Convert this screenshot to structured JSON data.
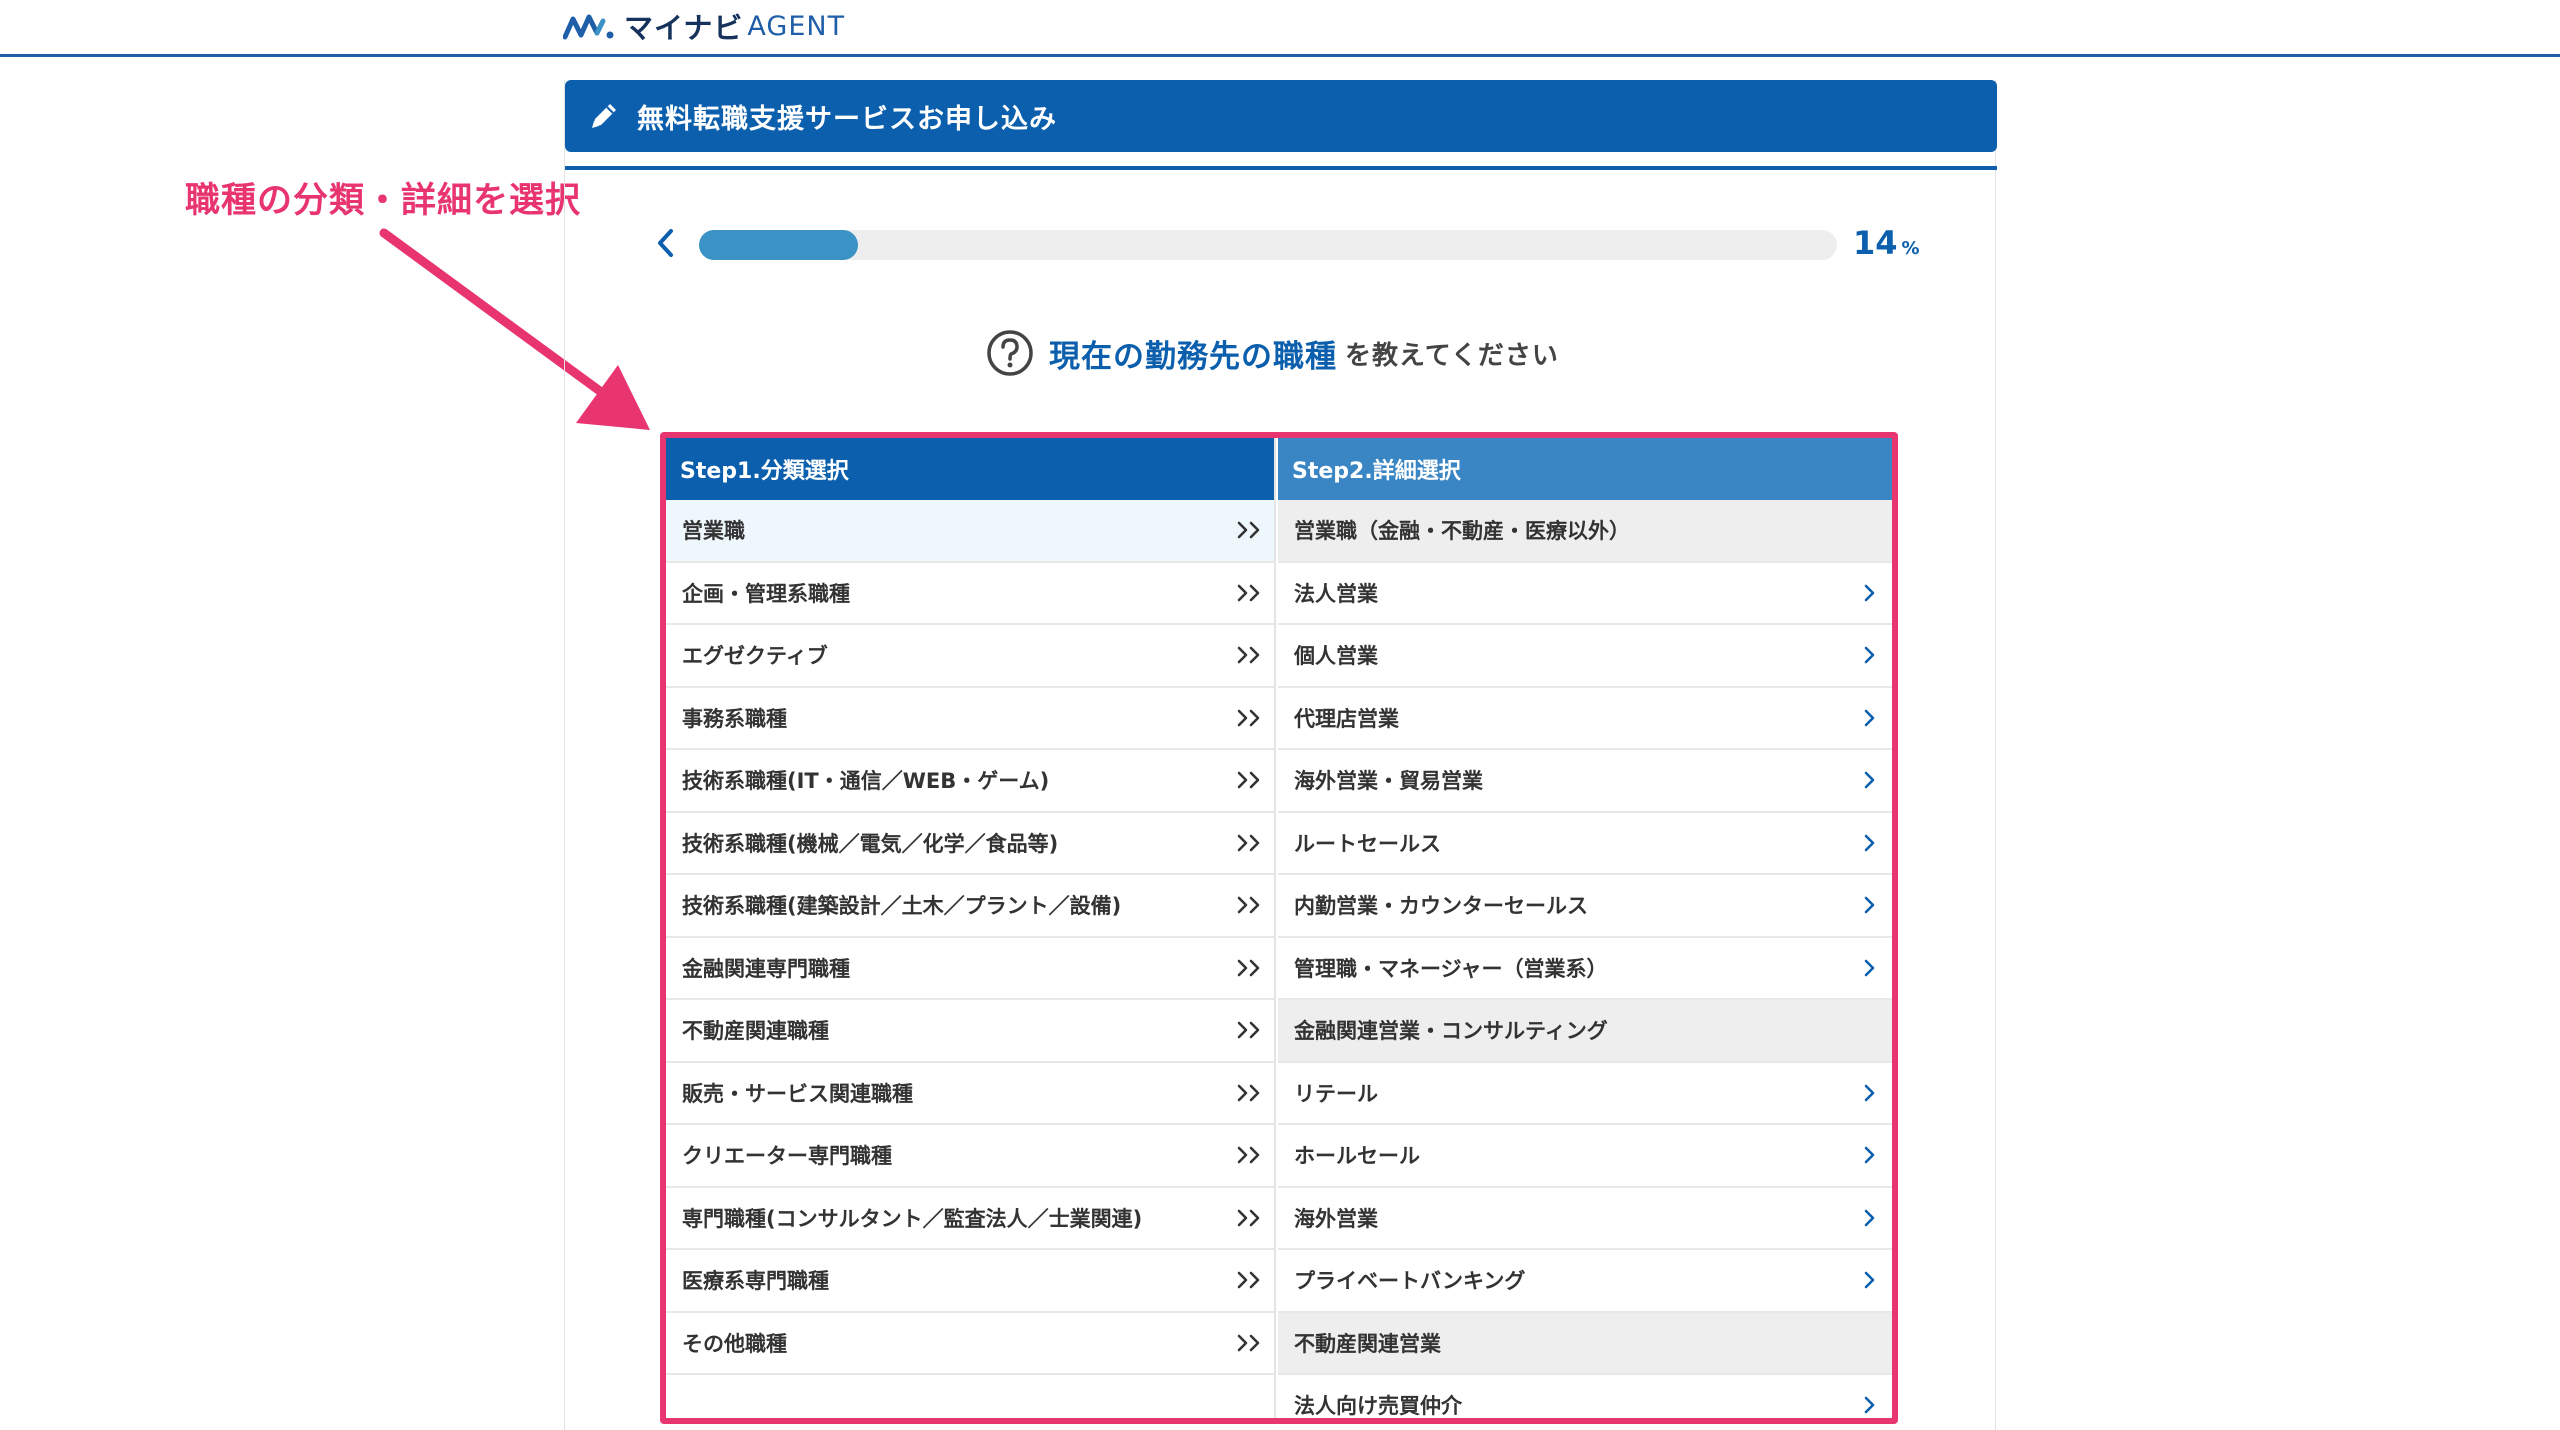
{
  "header": {
    "logo_text": "マイナビ",
    "logo_agent": "AGENT"
  },
  "form": {
    "title": "無料転職支援サービスお申し込み",
    "progress": {
      "value_percent": 14,
      "label_number": "14",
      "label_unit": "%"
    },
    "question": {
      "emphasis": "現在の勤務先の職種",
      "rest": "を教えてください"
    }
  },
  "annotation": {
    "text": "職種の分類・詳細を選択",
    "color": "#e8356f"
  },
  "selector": {
    "step1_title": "Step1.分類選択",
    "step2_title": "Step2.詳細選択",
    "categories": [
      "営業職",
      "企画・管理系職種",
      "エグゼクティブ",
      "事務系職種",
      "技術系職種(IT・通信／WEB・ゲーム)",
      "技術系職種(機械／電気／化学／食品等)",
      "技術系職種(建築設計／土木／プラント／設備)",
      "金融関連専門職種",
      "不動産関連職種",
      "販売・サービス関連職種",
      "クリエーター専門職種",
      "専門職種(コンサルタント／監査法人／士業関連)",
      "医療系専門職種",
      "その他職種"
    ],
    "selected_category": "営業職",
    "details": [
      {
        "label": "営業職（金融・不動産・医療以外）",
        "type": "group"
      },
      {
        "label": "法人営業",
        "type": "item"
      },
      {
        "label": "個人営業",
        "type": "item"
      },
      {
        "label": "代理店営業",
        "type": "item"
      },
      {
        "label": "海外営業・貿易営業",
        "type": "item"
      },
      {
        "label": "ルートセールス",
        "type": "item"
      },
      {
        "label": "内勤営業・カウンターセールス",
        "type": "item"
      },
      {
        "label": "管理職・マネージャー（営業系）",
        "type": "item"
      },
      {
        "label": "金融関連営業・コンサルティング",
        "type": "group"
      },
      {
        "label": "リテール",
        "type": "item"
      },
      {
        "label": "ホールセール",
        "type": "item"
      },
      {
        "label": "海外営業",
        "type": "item"
      },
      {
        "label": "プライベートバンキング",
        "type": "item"
      },
      {
        "label": "不動産関連営業",
        "type": "group"
      },
      {
        "label": "法人向け売買仲介",
        "type": "item"
      }
    ]
  },
  "colors": {
    "brand_blue": "#0b5fad",
    "step2_blue": "#3a86c5",
    "progress_fill": "#3a93c4",
    "highlight_pink": "#e8356f"
  }
}
